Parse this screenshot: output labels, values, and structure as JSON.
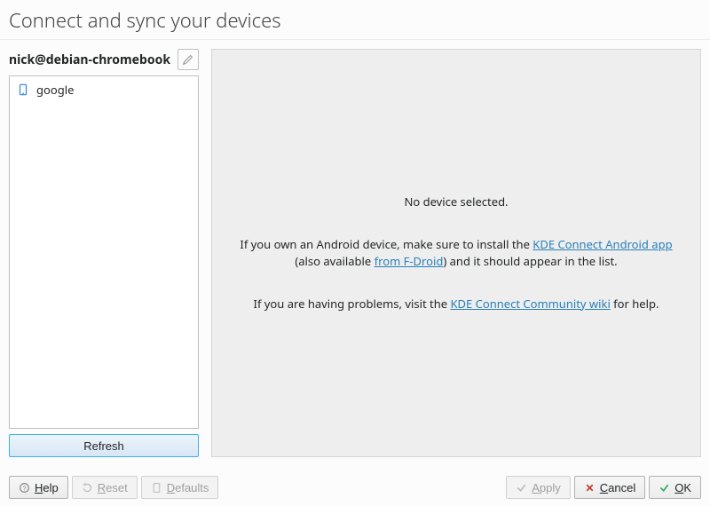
{
  "title": "Connect and sync your devices",
  "hostname": "nick@debian-chromebook",
  "devices": [
    {
      "name": "google",
      "icon": "smartphone"
    }
  ],
  "refresh_label": "Refresh",
  "detail": {
    "no_device": "No device selected.",
    "android_pre": "If you own an Android device, make sure to install the ",
    "android_link1": "KDE Connect Android app",
    "android_mid": " (also available ",
    "android_link2": "from F-Droid",
    "android_post": ") and it should appear in the list.",
    "help_pre": "If you are having problems, visit the ",
    "help_link": "KDE Connect Community wiki",
    "help_post": " for help."
  },
  "buttons": {
    "help": "elp",
    "help_ul": "H",
    "reset": "eset",
    "reset_ul": "R",
    "defaults": "efaults",
    "defaults_ul": "D",
    "apply": "pply",
    "apply_ul": "A",
    "cancel": "ancel",
    "cancel_ul": "C",
    "ok": "K",
    "ok_ul": "O"
  }
}
